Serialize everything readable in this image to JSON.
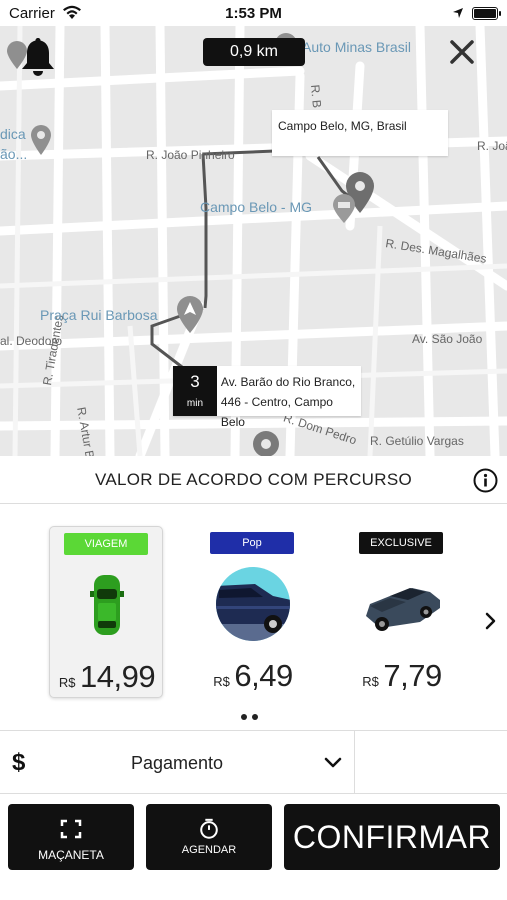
{
  "status_bar": {
    "carrier": "Carrier",
    "time": "1:53 PM"
  },
  "map": {
    "distance": "0,9 km",
    "destination": "Campo Belo, MG, Brasil",
    "eta": {
      "value": "3",
      "unit": "min",
      "address_line1": "Av. Barão do Rio Branco,",
      "address_line2": "446 - Centro, Campo Belo"
    },
    "street_labels": [
      "R. João Pinheiro",
      "R. Des. Magalhães",
      "R. João",
      "al. Deodoro",
      "Av. São João",
      "R. Tiradentes",
      "R. Artur Bernardes",
      "R. Dom Pedro",
      "R. Getúlio Vargas",
      "R. B"
    ],
    "place_labels": [
      "Auto Minas Brasil",
      "Campo Belo - MG",
      "Praça Rui Barbosa",
      "dica",
      "ão..."
    ]
  },
  "ride_options": {
    "header": "VALOR DE ACORDO COM PERCURSO",
    "categories": [
      {
        "badge": "VIAGEM",
        "badge_color": "#5bd836",
        "currency": "R$",
        "price": "14,99",
        "selected": true,
        "icon": "green-car-icon"
      },
      {
        "badge": "Pop",
        "badge_color": "#1f2ea8",
        "currency": "R$",
        "price": "6,49",
        "selected": false,
        "icon": "pop-car-icon"
      },
      {
        "badge": "EXCLUSIVE",
        "badge_color": "#111111",
        "currency": "R$",
        "price": "7,79",
        "selected": false,
        "icon": "exclusive-car-icon"
      }
    ]
  },
  "payment": {
    "currency_symbol": "$",
    "label": "Pagamento"
  },
  "actions": {
    "macaneta": "MAÇANETA",
    "agendar": "AGENDAR",
    "confirm": "CONFIRMAR"
  }
}
